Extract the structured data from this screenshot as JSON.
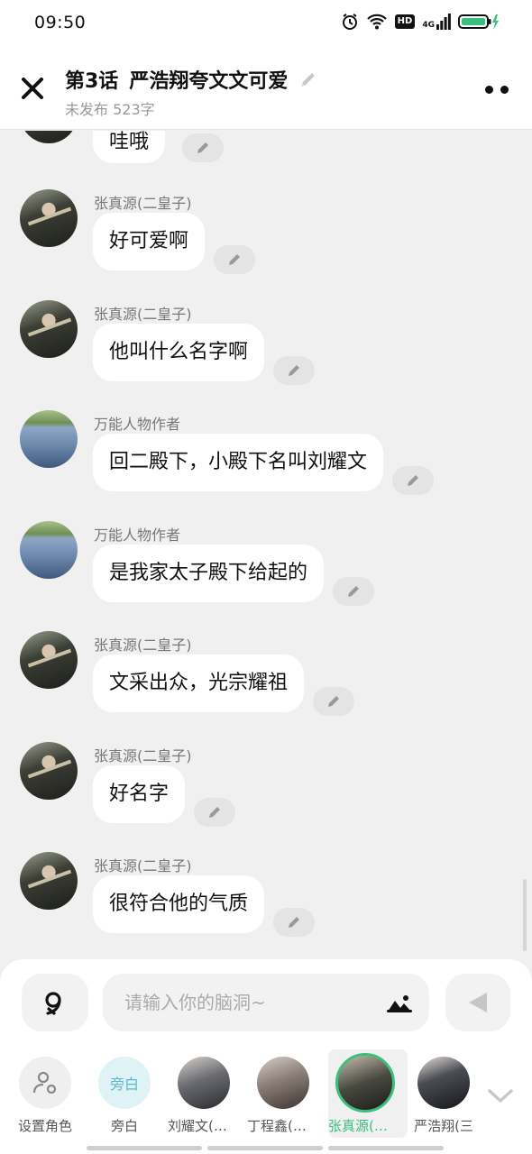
{
  "status_bar": {
    "time": "09:50",
    "hd": "HD",
    "network": "4G"
  },
  "header": {
    "chapter": "第3话",
    "title": "严浩翔夸文文可爱",
    "subtitle": "未发布 523字"
  },
  "partial_message": {
    "text": "哇哦"
  },
  "messages": [
    {
      "sender": "张真源(二皇子)",
      "text": "好可爱啊",
      "avatar": "dark"
    },
    {
      "sender": "张真源(二皇子)",
      "text": "他叫什么名字啊",
      "avatar": "dark"
    },
    {
      "sender": "万能人物作者",
      "text": "回二殿下，小殿下名叫刘耀文",
      "avatar": "lake"
    },
    {
      "sender": "万能人物作者",
      "text": "是我家太子殿下给起的",
      "avatar": "lake"
    },
    {
      "sender": "张真源(二皇子)",
      "text": "文采出众，光宗耀祖",
      "avatar": "dark"
    },
    {
      "sender": "张真源(二皇子)",
      "text": "好名字",
      "avatar": "dark"
    },
    {
      "sender": "张真源(二皇子)",
      "text": "很符合他的气质",
      "avatar": "dark"
    }
  ],
  "input": {
    "placeholder": "请输入你的脑洞~"
  },
  "roles": [
    {
      "label": "设置角色",
      "kind": "settings"
    },
    {
      "label": "旁白",
      "kind": "narrator",
      "avatar_text": "旁白"
    },
    {
      "label": "刘耀文(四...",
      "kind": "p1"
    },
    {
      "label": "丁程鑫(太...",
      "kind": "p2"
    },
    {
      "label": "张真源(二...",
      "kind": "p3",
      "active": true
    },
    {
      "label": "严浩翔(三",
      "kind": "p4"
    }
  ],
  "colors": {
    "accent": "#3bbf7d",
    "bubble": "#ffffff",
    "background": "#f0f0f0"
  }
}
